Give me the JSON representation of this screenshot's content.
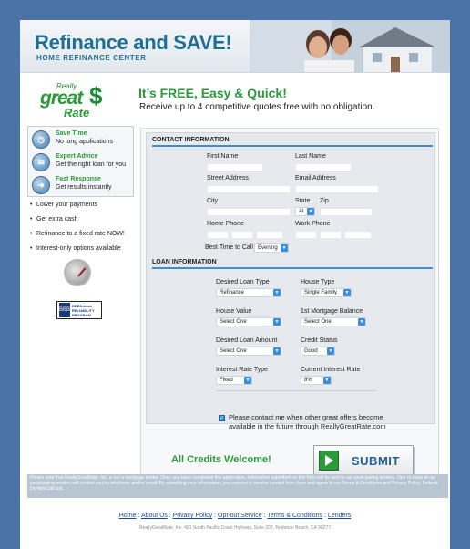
{
  "header": {
    "title": "Refinance and SAVE!",
    "subtitle": "HOME REFINANCE CENTER"
  },
  "logo": {
    "really": "Really",
    "great": "great",
    "dollar": "$",
    "rate": "Rate"
  },
  "promo": {
    "title": "It’s FREE, Easy & Quick!",
    "subtitle": "Receive up to 4 competitive quotes free with no obligation."
  },
  "features": [
    {
      "title": "Save Time",
      "desc": "No long applications",
      "icon": "clock-icon"
    },
    {
      "title": "Expert Advice",
      "desc": "Get the right loan for you",
      "icon": "advice-icon"
    },
    {
      "title": "Fast Response",
      "desc": "Get results instantly",
      "icon": "response-icon"
    }
  ],
  "bullets": [
    "Lower your payments",
    "Get extra cash",
    "Refinance to a fixed rate NOW!",
    "Interest-only options available"
  ],
  "bbb": {
    "seal": "BBB",
    "text": "BBBOnLine RELIABILITY PROGRAM"
  },
  "contact": {
    "heading": "CONTACT INFORMATION",
    "first_name": "First Name",
    "last_name": "Last Name",
    "street": "Street Address",
    "email": "Email Address",
    "city": "City",
    "state": "State",
    "state_value": "AL",
    "zip": "Zip",
    "home_phone": "Home Phone",
    "work_phone": "Work Phone",
    "best_time": "Best Time to Call",
    "best_time_value": "Evening"
  },
  "loan": {
    "heading": "LOAN INFORMATION",
    "desired_loan_type": "Desired Loan Type",
    "desired_loan_type_value": "Refinance",
    "house_type": "House Type",
    "house_type_value": "Single Family",
    "house_value": "House Value",
    "house_value_value": "Select One",
    "first_mortgage": "1st Mortgage Balance",
    "first_mortgage_value": "Select One",
    "desired_amount": "Desired Loan Amount",
    "desired_amount_value": "Select One",
    "credit_status": "Credit Status",
    "credit_status_value": "Good",
    "rate_type": "Interest Rate Type",
    "rate_type_value": "Fixed",
    "current_rate": "Current Interest Rate",
    "current_rate_value": "8%"
  },
  "consent": {
    "text": "Please contact me when other great offers become available in the future through ReallyGreatRate.com"
  },
  "credits": "All Credits Welcome!",
  "submit": "SUBMIT",
  "footer": {
    "disclaimer": "Please note that ReallyGreatRate, Inc. is not a mortgage lender. Once you have completed this application, information submitted on this form will be sent to our participating lenders. One or more of our participating lenders will contact you by telephone and/or email. By submitting your information, you consent to receive contact from them and agree to our Terms & Conditions and Privacy Policy. Federal Do-Not-Call List.",
    "links": [
      "Home",
      "About Us",
      "Privacy Policy",
      "Opt-out Service",
      "Terms & Conditions",
      "Lenders"
    ],
    "address": "ReallyGreatRate, Inc. 401 South Pacific Coast Highway, Suite 202, Redondo Beach, CA 90277"
  }
}
